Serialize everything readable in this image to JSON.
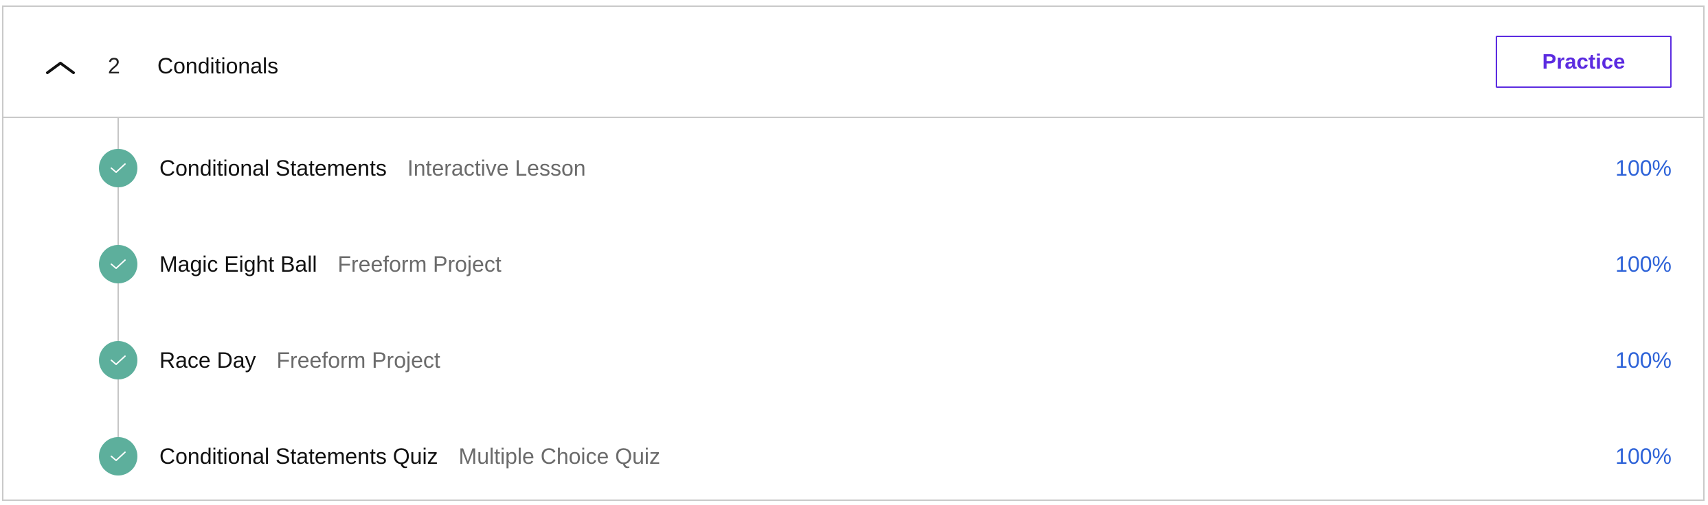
{
  "section": {
    "number": "2",
    "title": "Conditionals",
    "expand_icon": "chevron-up-icon",
    "practice_label": "Practice"
  },
  "colors": {
    "accent_purple": "#5b2be0",
    "check_green": "#5daf9c",
    "percent_blue": "#2e63d8",
    "type_gray": "#6b6b6b",
    "border_gray": "#c9c9c9"
  },
  "lessons": [
    {
      "title": "Conditional Statements",
      "type": "Interactive Lesson",
      "percent": "100%",
      "status_icon": "check-circle-icon"
    },
    {
      "title": "Magic Eight Ball",
      "type": "Freeform Project",
      "percent": "100%",
      "status_icon": "check-circle-icon"
    },
    {
      "title": "Race Day",
      "type": "Freeform Project",
      "percent": "100%",
      "status_icon": "check-circle-icon"
    },
    {
      "title": "Conditional Statements Quiz",
      "type": "Multiple Choice Quiz",
      "percent": "100%",
      "status_icon": "check-circle-icon"
    }
  ]
}
